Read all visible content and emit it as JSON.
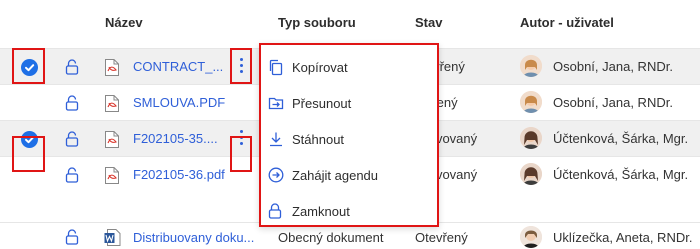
{
  "colors": {
    "accent": "#2f5fd8",
    "check": "#1e6fe6",
    "highlight": "#e01515",
    "selected_row": "#f0f0f0"
  },
  "header": {
    "name": "Název",
    "type": "Typ souboru",
    "state": "Stav",
    "author": "Autor - uživatel"
  },
  "rows": [
    {
      "selected": true,
      "file_icon": "pdf-icon",
      "name": "CONTRACT_...",
      "type": "",
      "state": "otevřený",
      "author": "Osobní, Jana, RNDr."
    },
    {
      "selected": false,
      "file_icon": "pdf-icon",
      "name": "SMLOUVA.PDF",
      "type": "",
      "state": "tevřený",
      "author": "Osobní, Jana, RNDr."
    },
    {
      "selected": true,
      "file_icon": "pdf-icon",
      "name": "F202105-35....",
      "type": "",
      "state": "rchivovaný",
      "author": "Účtenková, Šárka, Mgr."
    },
    {
      "selected": false,
      "file_icon": "pdf-icon",
      "name": "F202105-36.pdf",
      "type": "",
      "state": "rchivovaný",
      "author": "Účtenková, Šárka, Mgr."
    },
    {
      "selected": false,
      "file_icon": "word-icon",
      "name": "Distribuovany doku...",
      "type": "Obecný dokument",
      "state": "Otevřený",
      "author": "Uklízečka, Aneta, RNDr."
    }
  ],
  "menu": {
    "items": [
      {
        "icon": "copy-icon",
        "label": "Kopírovat"
      },
      {
        "icon": "move-icon",
        "label": "Přesunout"
      },
      {
        "icon": "download-icon",
        "label": "Stáhnout"
      },
      {
        "icon": "start-agenda-icon",
        "label": "Zahájit agendu"
      },
      {
        "icon": "lock-icon",
        "label": "Zamknout"
      }
    ]
  }
}
